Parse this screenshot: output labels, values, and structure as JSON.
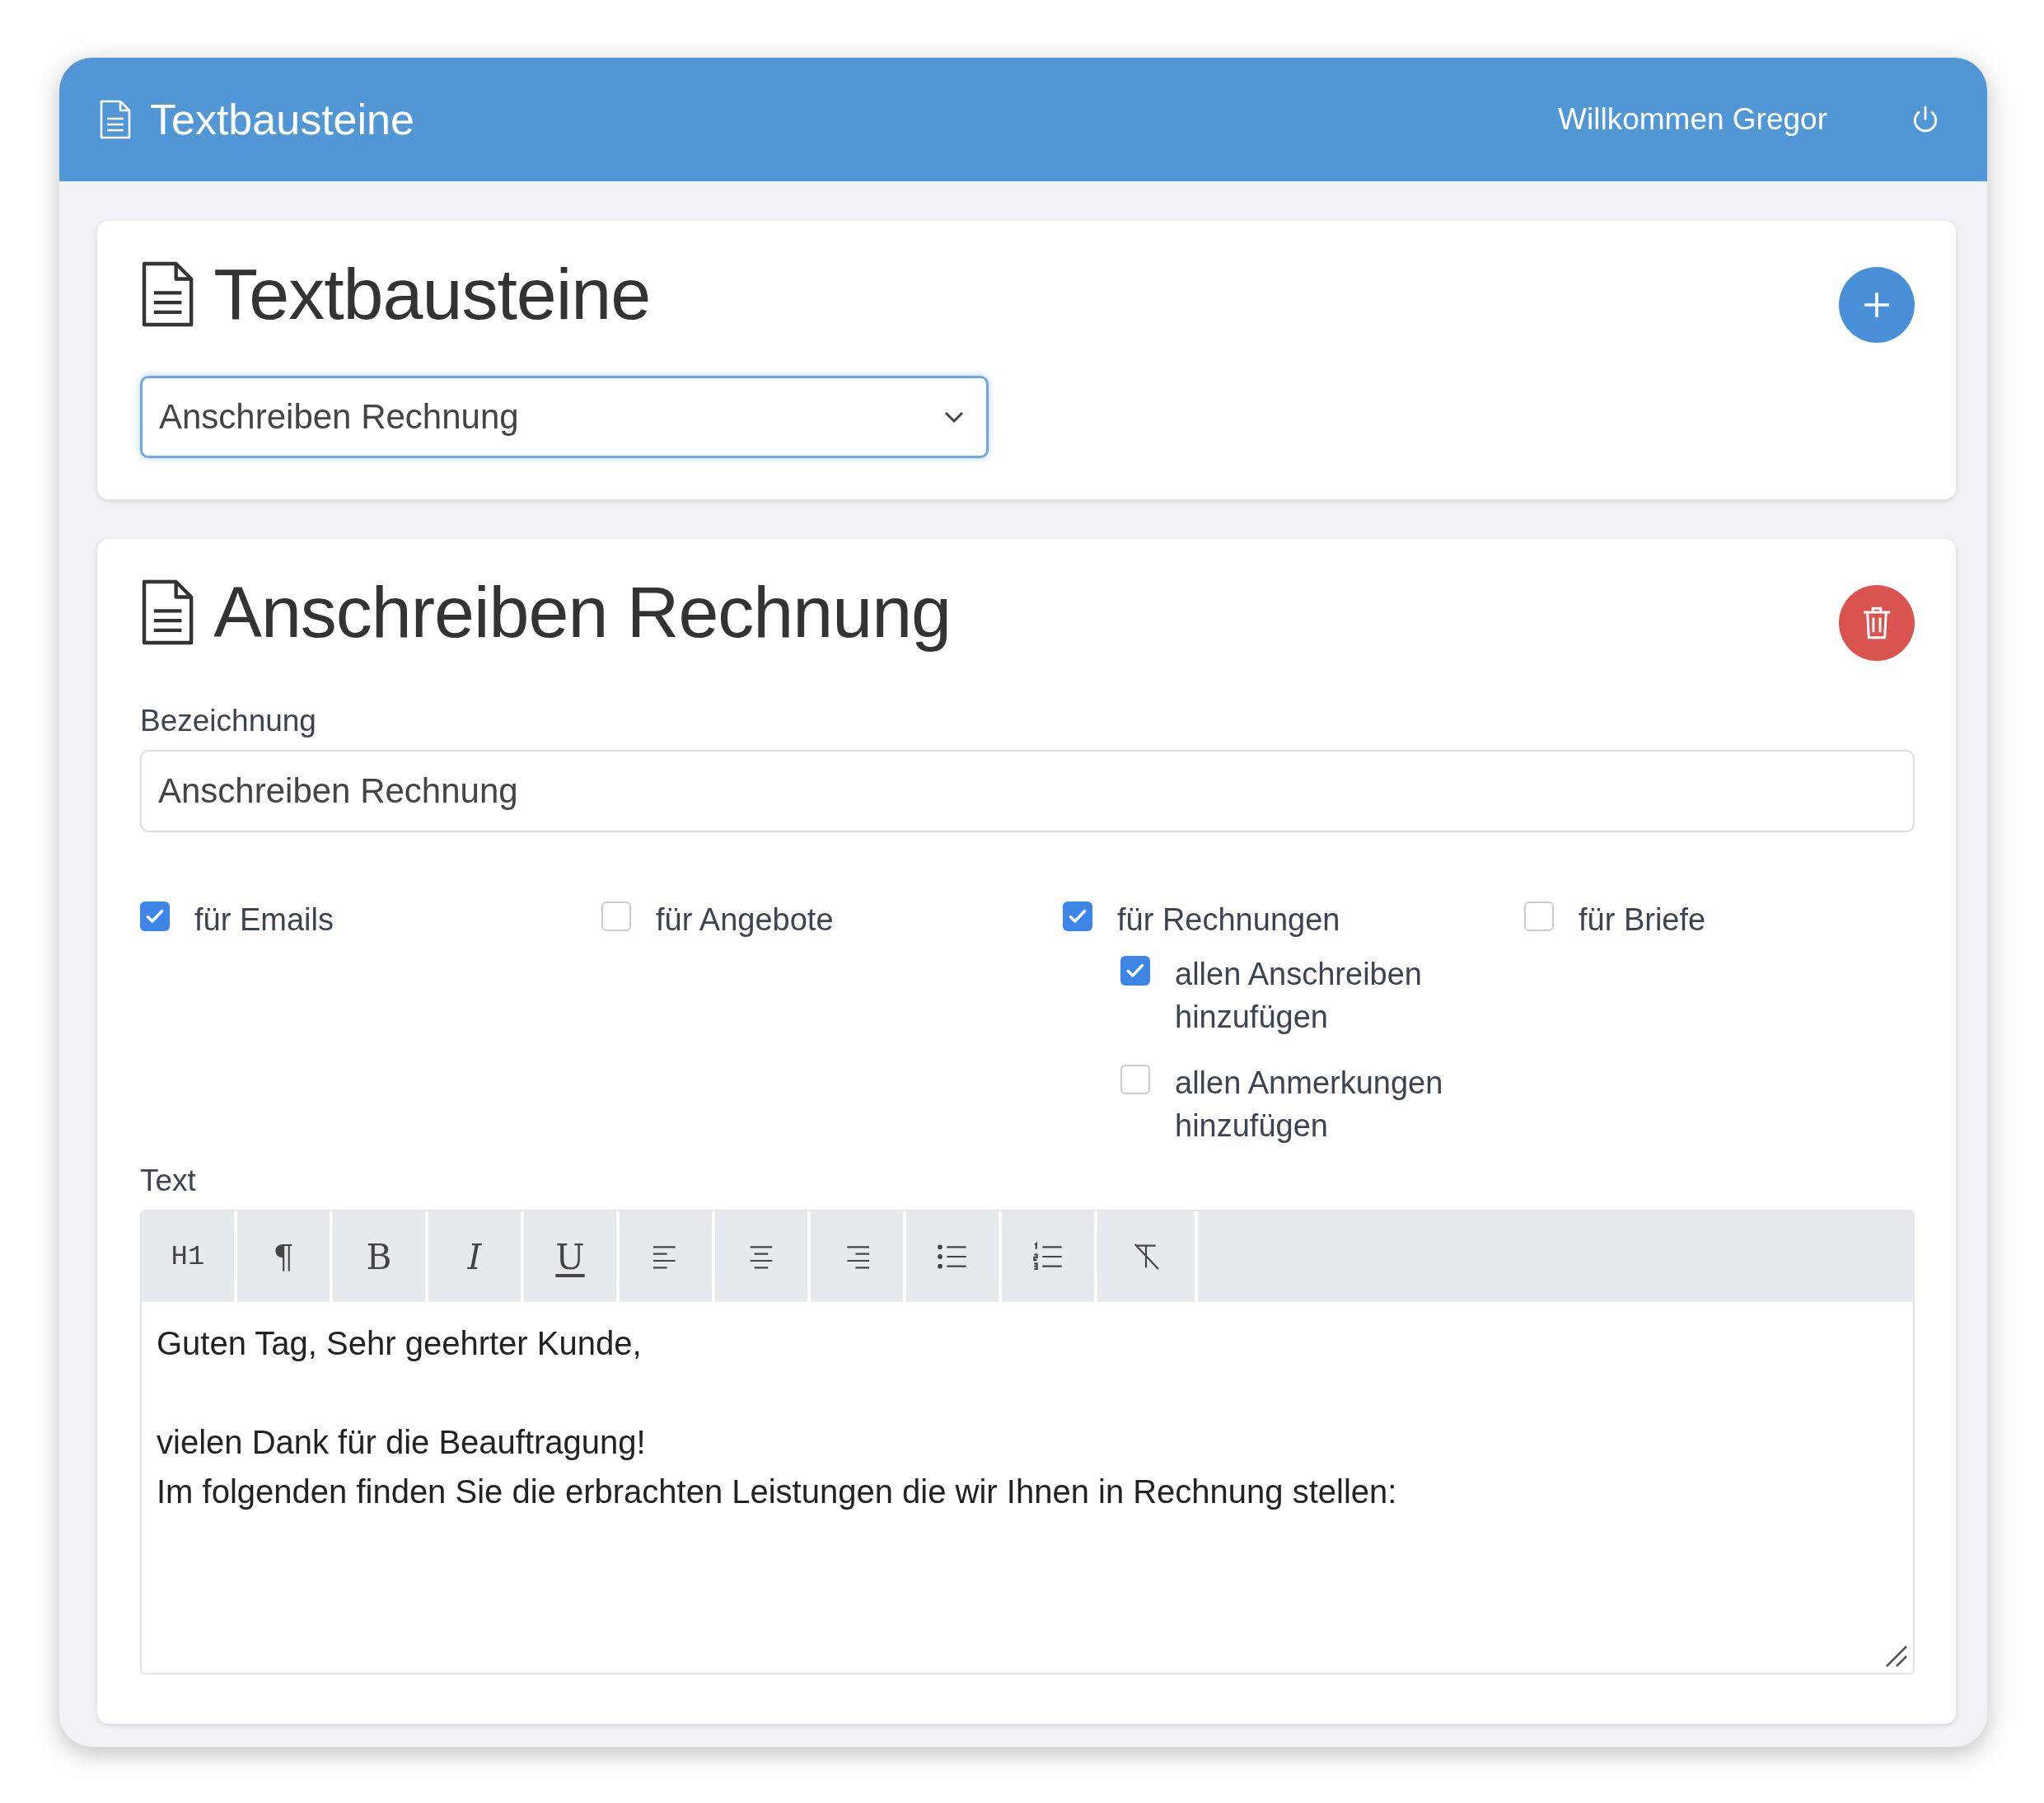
{
  "header": {
    "title": "Textbausteine",
    "welcome": "Willkommen Gregor"
  },
  "selector_card": {
    "heading": "Textbausteine",
    "select": {
      "value": "Anschreiben Rechnung"
    }
  },
  "editor_card": {
    "heading": "Anschreiben Rechnung",
    "name_field": {
      "label": "Bezeichnung",
      "value": "Anschreiben Rechnung"
    },
    "options": [
      {
        "label": "für Emails",
        "checked": true
      },
      {
        "label": "für Angebote",
        "checked": false
      },
      {
        "label": "für Rechnungen",
        "checked": true,
        "children": [
          {
            "label": "allen Anschreiben hinzufügen",
            "checked": true
          },
          {
            "label": "allen Anmerkungen hinzufügen",
            "checked": false
          }
        ]
      },
      {
        "label": "für Briefe",
        "checked": false
      }
    ],
    "text_label": "Text",
    "toolbar": [
      {
        "kind": "heading",
        "label": "H1"
      },
      {
        "kind": "paragraph",
        "label": "¶"
      },
      {
        "kind": "bold",
        "label": "B"
      },
      {
        "kind": "italic",
        "label": "I"
      },
      {
        "kind": "underline",
        "label": "U"
      },
      {
        "kind": "align-left"
      },
      {
        "kind": "align-center"
      },
      {
        "kind": "align-right"
      },
      {
        "kind": "bullet-list"
      },
      {
        "kind": "numbered-list"
      },
      {
        "kind": "clear-format"
      }
    ],
    "paragraphs": [
      [
        "Guten Tag, Sehr geehrter Kunde,"
      ],
      [
        "vielen Dank für die Beauftragung!",
        "Im folgenden finden Sie die erbrachten Leistungen die wir Ihnen in Rechnung stellen:"
      ]
    ]
  }
}
